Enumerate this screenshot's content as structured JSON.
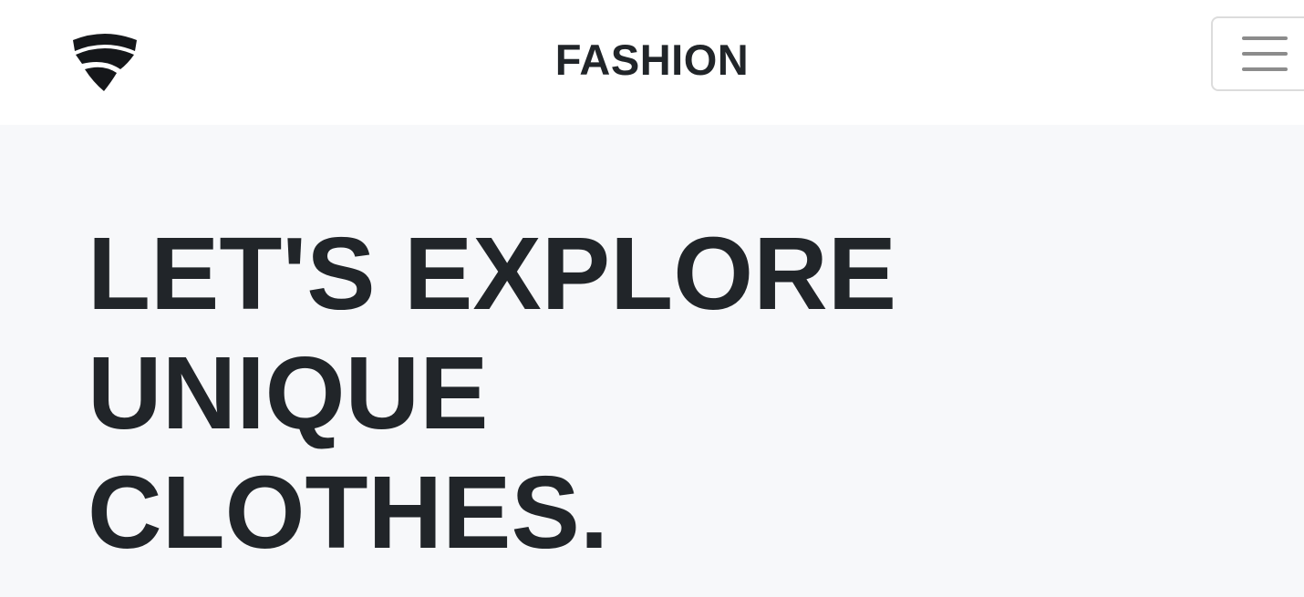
{
  "navbar": {
    "logo_icon": "shield-logo-icon",
    "brand": "FASHION",
    "menu_icon": "hamburger-menu-icon"
  },
  "hero": {
    "title_lines": [
      "LET'S EXPLORE",
      "UNIQUE",
      "CLOTHES."
    ],
    "background": "#f7f8fa",
    "text_color": "#212529"
  }
}
